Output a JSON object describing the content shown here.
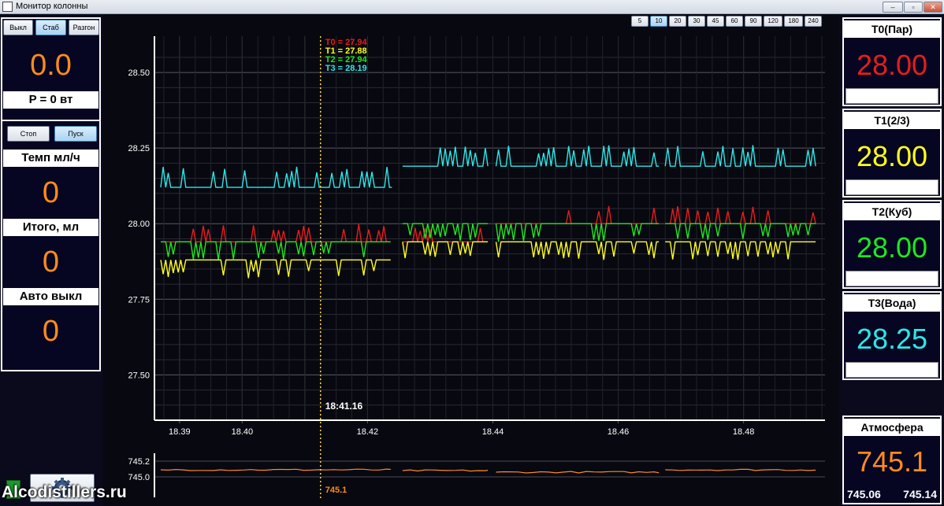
{
  "window": {
    "title": "Монитор колонны"
  },
  "left": {
    "mode_buttons": [
      "Выкл",
      "Стаб",
      "Разгон"
    ],
    "mode_selected": 1,
    "power_value": "0.0",
    "power_label": "P = 0 вт",
    "pump_buttons": [
      "Стоп",
      "Пуск"
    ],
    "pump_selected": 1,
    "rate_label": "Темп мл/ч",
    "rate_value": "0",
    "total_label": "Итого, мл",
    "total_value": "0",
    "auto_label": "Авто выкл",
    "auto_value": "0"
  },
  "time_buttons": [
    "5",
    "10",
    "20",
    "30",
    "45",
    "60",
    "90",
    "120",
    "180",
    "240"
  ],
  "time_selected": 1,
  "sensors": [
    {
      "title": "T0(Пар)",
      "value": "28.00",
      "color": "#e81c1c"
    },
    {
      "title": "T1(2/3)",
      "value": "28.00",
      "color": "#ffff1e"
    },
    {
      "title": "T2(Куб)",
      "value": "28.00",
      "color": "#1ee81e"
    },
    {
      "title": "T3(Вода)",
      "value": "28.25",
      "color": "#2ae8e8"
    }
  ],
  "atmosphere": {
    "title": "Атмосфера",
    "value": "745.1",
    "min": "745.06",
    "max": "745.14",
    "color": "#ff8c1a"
  },
  "cursor": {
    "time": "18:41.16",
    "pressure": "745.1",
    "readouts": [
      {
        "text": "T0 = 27.94",
        "color": "#e81c1c"
      },
      {
        "text": "T1 = 27.88",
        "color": "#ffff1e"
      },
      {
        "text": "T2 = 27.94",
        "color": "#1ee81e"
      },
      {
        "text": "T3 = 28.19",
        "color": "#2ae8e8"
      }
    ]
  },
  "chart_data": {
    "type": "line",
    "x_unit": "minutes",
    "xlim": [
      18.386,
      18.493
    ],
    "ylim": [
      27.35,
      28.62
    ],
    "y_ticks": [
      27.5,
      27.75,
      28.0,
      28.25,
      28.5
    ],
    "y_tick_labels": [
      "27.50",
      "27.75",
      "28.00",
      "28.25",
      "28.50"
    ],
    "x_ticks": [
      18.39,
      18.4,
      18.42,
      18.44,
      18.46,
      18.48
    ],
    "x_tick_labels": [
      "18.39",
      "18.40",
      "18.42",
      "18.44",
      "18.46",
      "18.48"
    ],
    "x_minor_ticks": [
      18.41,
      18.43,
      18.45,
      18.47
    ],
    "gaps": [
      [
        18.4246,
        18.4256
      ],
      [
        18.4392,
        18.4405
      ],
      [
        18.4665,
        18.4675
      ]
    ],
    "series": [
      {
        "color": "#2ae8e8",
        "segments": [
          {
            "x": [
              18.387,
              18.396,
              18.4035,
              18.417,
              18.4237
            ],
            "base": 28.12,
            "spikes": [
              [
                18.3875,
                18.389,
                28.12,
                28.12
              ],
              [
                18.387,
                18.3885,
                28.06,
                28.12
              ],
              [
                18.3925,
                18.3945,
                28.06,
                28.12
              ],
              [
                18.4035,
                18.4237,
                28.19,
                28.12
              ]
            ]
          }
        ],
        "levels": [
          {
            "x0": 18.387,
            "x1": 18.396,
            "y": 28.12
          },
          {
            "x0": 18.396,
            "x1": 18.4035,
            "y": 28.12
          },
          {
            "x0": 18.4035,
            "x1": 18.4237,
            "y": 28.12
          },
          {
            "x0": 18.4256,
            "x1": 18.4392,
            "y": 28.19
          },
          {
            "x0": 18.4405,
            "x1": 18.4665,
            "y": 28.19
          },
          {
            "x0": 18.4675,
            "x1": 18.4915,
            "y": 28.19
          }
        ]
      },
      {
        "color": "#e81c1c",
        "levels": [
          {
            "x0": 18.387,
            "x1": 18.4237,
            "y": 27.94
          },
          {
            "x0": 18.4256,
            "x1": 18.4392,
            "y": 27.94
          },
          {
            "x0": 18.4405,
            "x1": 18.4665,
            "y": 28.0
          },
          {
            "x0": 18.4675,
            "x1": 18.4915,
            "y": 28.0
          }
        ]
      },
      {
        "color": "#1ee81e",
        "levels": [
          {
            "x0": 18.387,
            "x1": 18.4237,
            "y": 27.94
          },
          {
            "x0": 18.4256,
            "x1": 18.4392,
            "y": 28.0
          },
          {
            "x0": 18.4405,
            "x1": 18.4665,
            "y": 28.0
          },
          {
            "x0": 18.4675,
            "x1": 18.4915,
            "y": 28.0
          }
        ]
      },
      {
        "color": "#ffff1e",
        "levels": [
          {
            "x0": 18.387,
            "x1": 18.4237,
            "y": 27.88
          },
          {
            "x0": 18.4256,
            "x1": 18.4392,
            "y": 27.94
          },
          {
            "x0": 18.4405,
            "x1": 18.4665,
            "y": 27.94
          },
          {
            "x0": 18.4675,
            "x1": 18.4915,
            "y": 27.94
          }
        ]
      }
    ],
    "pressure": {
      "ylim": [
        744.9,
        745.3
      ],
      "y_ticks": [
        745.0,
        745.2
      ],
      "y_tick_labels": [
        "745.0",
        "745.2"
      ],
      "color": "#ff8c1a",
      "levels": [
        {
          "x0": 18.387,
          "x1": 18.4237,
          "y": 745.09
        },
        {
          "x0": 18.4256,
          "x1": 18.4392,
          "y": 745.08
        },
        {
          "x0": 18.4405,
          "x1": 18.4665,
          "y": 745.06
        },
        {
          "x0": 18.4675,
          "x1": 18.4915,
          "y": 745.09
        }
      ]
    },
    "cursor_x": 18.4125
  }
}
